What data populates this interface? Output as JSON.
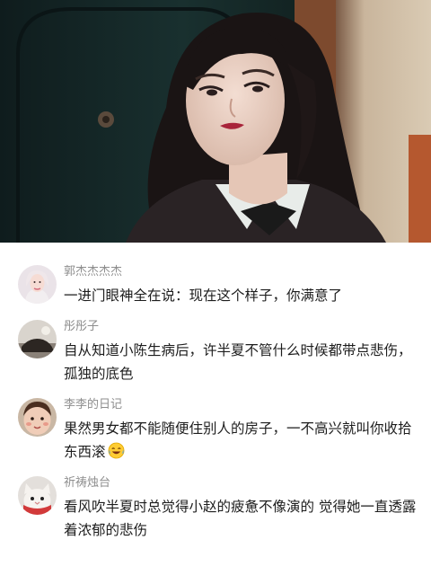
{
  "colors": {
    "username": "#8e8e8e",
    "comment_text": "#1d1d1d",
    "background": "#ffffff"
  },
  "hero": {
    "icon": "video-still-image"
  },
  "comments": [
    {
      "username": "郭杰杰杰杰",
      "text": "一进门眼神全在说：现在这个样子，你满意了",
      "emoji": ""
    },
    {
      "username": "彤彤子",
      "text": "自从知道小陈生病后，许半夏不管什么时候都带点悲伤，孤独的底色",
      "emoji": ""
    },
    {
      "username": "李李的日记",
      "text": "果然男女都不能随便住别人的房子，一不高兴就叫你收拾东西滚",
      "emoji": "laughing-crying-emoji"
    },
    {
      "username": "祈祷烛台",
      "text": "看风吹半夏时总觉得小赵的疲惫不像演的 觉得她一直透露着浓郁的悲伤",
      "emoji": ""
    }
  ]
}
